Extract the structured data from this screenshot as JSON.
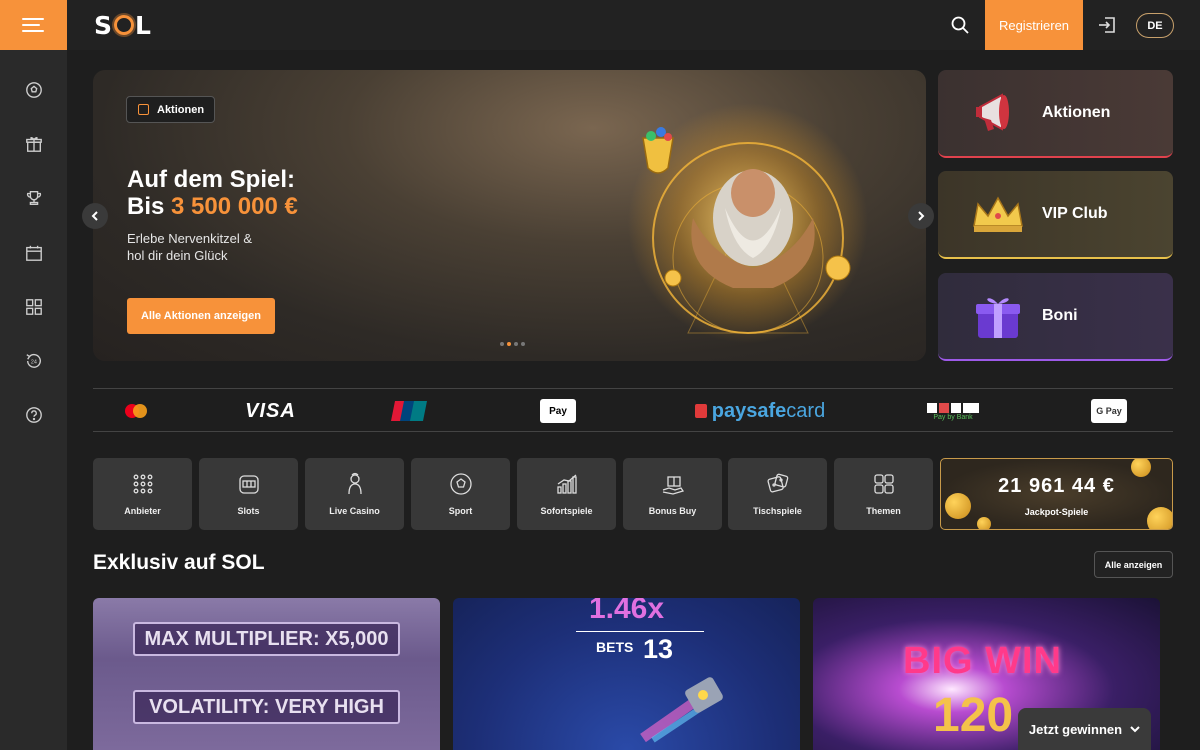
{
  "header": {
    "logo": "SOL",
    "register_label": "Registrieren",
    "language": "DE"
  },
  "sidebar": {
    "items": [
      {
        "name": "sport",
        "icon": "soccer-ball-icon"
      },
      {
        "name": "gifts",
        "icon": "gift-icon"
      },
      {
        "name": "tournaments",
        "icon": "trophy-icon"
      },
      {
        "name": "calendar",
        "icon": "calendar-icon"
      },
      {
        "name": "categories",
        "icon": "grid-icon"
      },
      {
        "name": "support-24",
        "icon": "support-24-icon"
      },
      {
        "name": "help",
        "icon": "help-icon"
      }
    ]
  },
  "hero": {
    "badge": "Aktionen",
    "title_line1": "Auf dem Spiel:",
    "title_prefix": "Bis ",
    "title_amount": "3 500 000 €",
    "subtitle": "Erlebe Nervenkitzel & hol dir dein Glück",
    "cta": "Alle Aktionen anzeigen",
    "slides": 4,
    "active_slide": 2
  },
  "promos": [
    {
      "label": "Aktionen",
      "icon": "megaphone-icon",
      "accent": "#e0424d"
    },
    {
      "label": "VIP Club",
      "icon": "crown-icon",
      "accent": "#e8c14b"
    },
    {
      "label": "Boni",
      "icon": "gift-box-icon",
      "accent": "#9d5ae8"
    }
  ],
  "payments": {
    "visa": "VISA",
    "unionpay": "UnionPay",
    "applepay": "Pay",
    "paysafe_a": "paysafe",
    "paysafe_b": "card",
    "paybybank": "Pay by Bank",
    "googlepay": "G Pay",
    "visa_small": "VISA"
  },
  "categories": [
    {
      "label": "Anbieter",
      "icon": "dots-grid-icon"
    },
    {
      "label": "Slots",
      "icon": "slot-machine-icon"
    },
    {
      "label": "Live Casino",
      "icon": "dealer-icon"
    },
    {
      "label": "Sport",
      "icon": "soccer-ball-icon"
    },
    {
      "label": "Sofortspiele",
      "icon": "bar-chart-icon"
    },
    {
      "label": "Bonus Buy",
      "icon": "gift-hand-icon"
    },
    {
      "label": "Tischspiele",
      "icon": "dice-icon"
    },
    {
      "label": "Themen",
      "icon": "squares-icon"
    }
  ],
  "jackpot": {
    "amount": "21 961 44",
    "currency": "€",
    "label": "Jackpot-Spiele"
  },
  "section": {
    "title": "Exklusiv auf SOL",
    "view_all": "Alle anzeigen"
  },
  "games": {
    "g1_line1": "MAX MULTIPLIER: X5,000",
    "g1_line2": "VOLATILITY: VERY HIGH",
    "g2_multiplier": "1.46x",
    "g2_bets_label": "BETS",
    "g2_bets_value": "13",
    "g3_big_win": "BIG WIN",
    "g3_value": "120"
  },
  "win_button": "Jetzt gewinnen"
}
